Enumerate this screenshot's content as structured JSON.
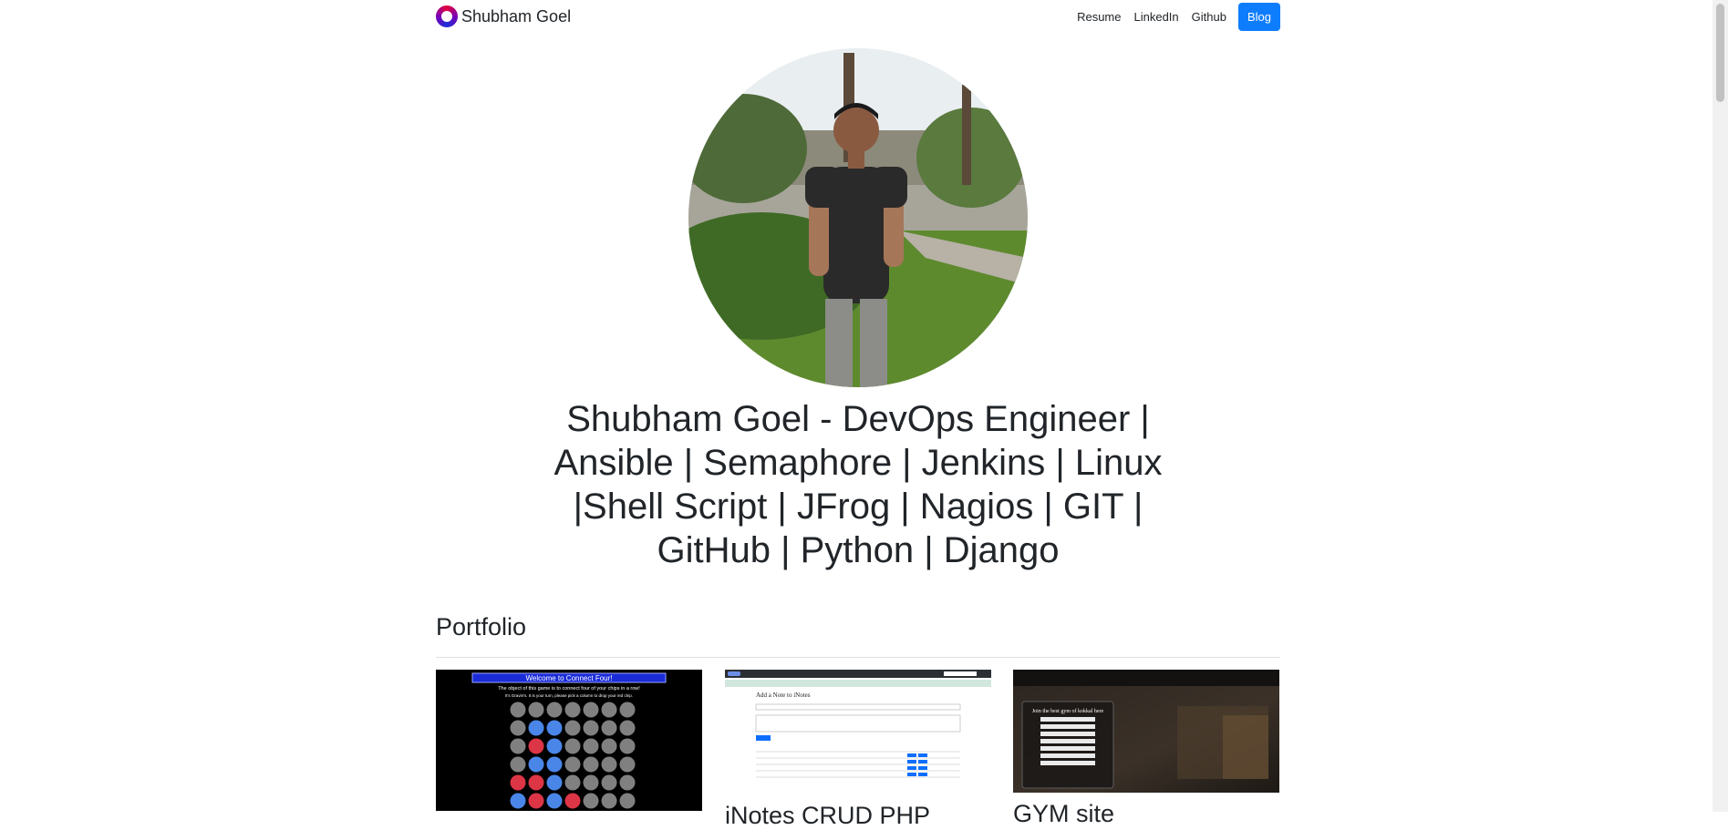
{
  "brand": {
    "name": "Shubham Goel",
    "logo_icon": "ring-logo-icon"
  },
  "nav": {
    "resume": "Resume",
    "linkedin": "LinkedIn",
    "github": "Github",
    "blog": "Blog"
  },
  "hero": {
    "headline": "Shubham Goel - DevOps Engineer | Ansible | Semaphore | Jenkins | Linux |Shell Script | JFrog | Nagios | GIT | GitHub | Python | Django"
  },
  "portfolio": {
    "title": "Portfolio",
    "cards": [
      {
        "title": "",
        "thumb_header": "Welcome to Connect Four!",
        "thumb_sub": "The object of this game is to connect four of your chips in a row!",
        "thumb_turn": "It's Gravin's. It is your turn, please pick a column to drop your red chip."
      },
      {
        "title": "iNotes CRUD PHP",
        "thumb_header": "Add a Note to iNotes"
      },
      {
        "title": "GYM site",
        "thumb_header": "Join the best gym of kokkal here"
      }
    ]
  },
  "colors": {
    "blog_button": "#0d7dfd",
    "text": "#212529",
    "divider": "#dee2e6"
  }
}
